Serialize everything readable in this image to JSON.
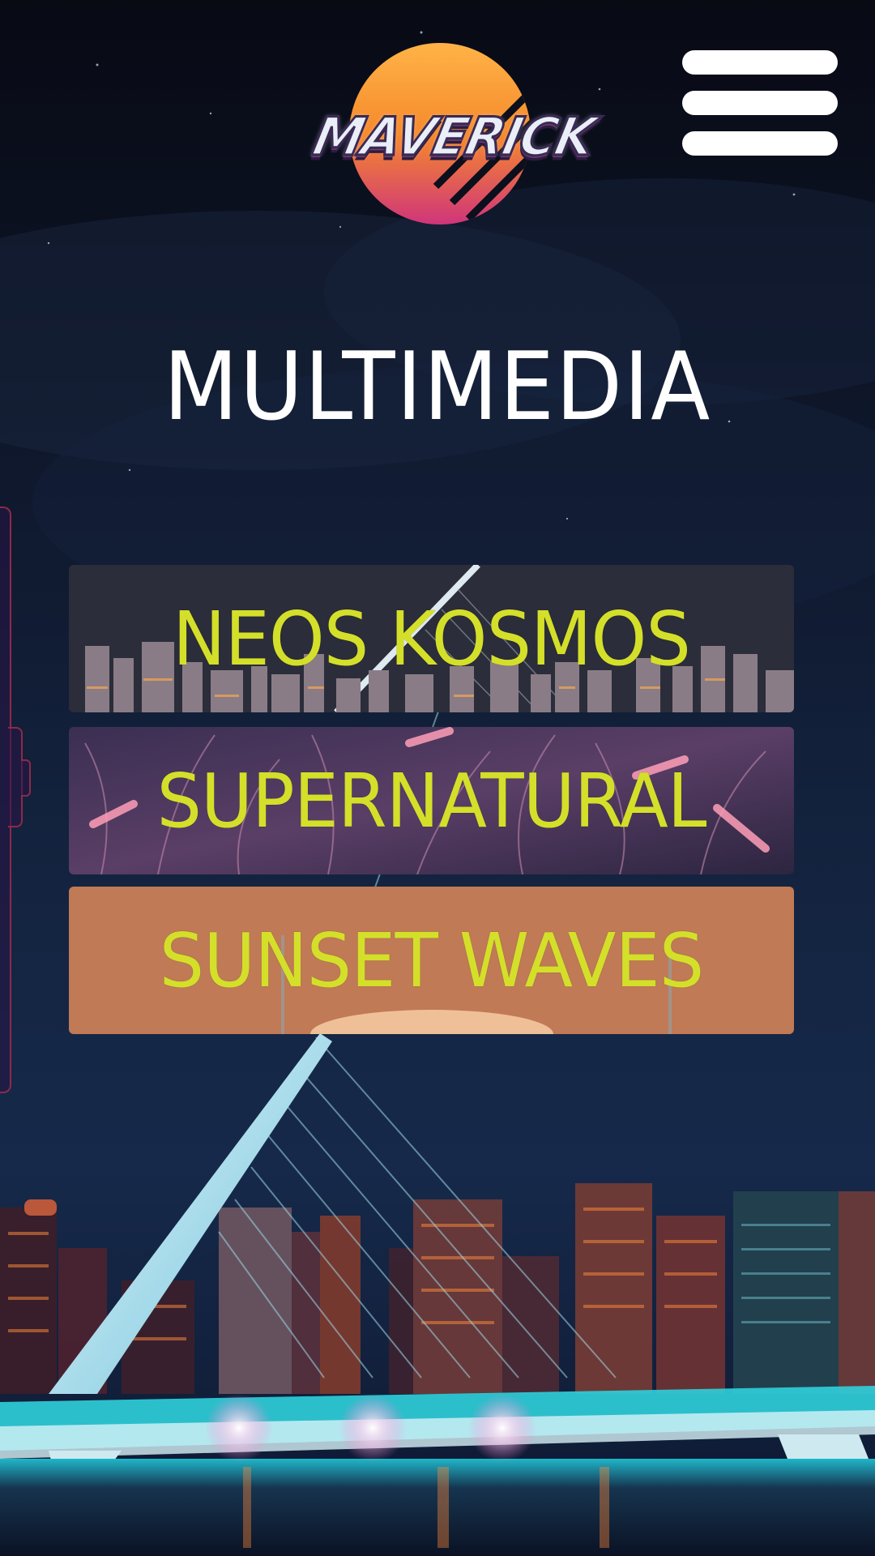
{
  "header": {
    "logo_text": "MAVERICK",
    "menu_icon": "hamburger-menu-icon"
  },
  "page": {
    "title": "MULTIMEDIA"
  },
  "albums": [
    {
      "label": "NEOS KOSMOS",
      "theme": "city-skyline"
    },
    {
      "label": "SUPERNATURAL",
      "theme": "neon-grass"
    },
    {
      "label": "SUNSET WAVES",
      "theme": "sunset"
    }
  ],
  "colors": {
    "label_yellow": "#d4df2a",
    "title_white": "#ffffff",
    "sky_top": "#0a0d18",
    "sky_mid": "#13203a",
    "bridge_cyan": "#3fe0e6",
    "sunset_panel": "#c07a55",
    "side_tab_border": "#8c2a4a"
  }
}
